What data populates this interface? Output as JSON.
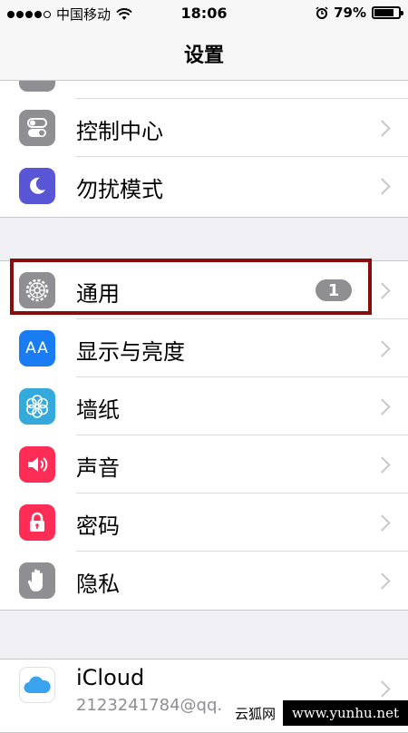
{
  "status_bar": {
    "carrier": "中国移动",
    "time": "18:06",
    "battery_percent": "79%",
    "battery_level": 0.79,
    "signal_dots": 4
  },
  "nav": {
    "title": "设置"
  },
  "groups": [
    {
      "items": [
        {
          "label": "控制中心",
          "icon": "control-center-icon",
          "color": "#8e8e93"
        },
        {
          "label": "勿扰模式",
          "icon": "moon-icon",
          "color": "#5856d6"
        }
      ]
    },
    {
      "items": [
        {
          "label": "通用",
          "icon": "gear-icon",
          "color": "#8e8e93",
          "badge": "1"
        },
        {
          "label": "显示与亮度",
          "icon": "text-size-icon",
          "color": "#1a7cf2"
        },
        {
          "label": "墙纸",
          "icon": "flower-icon",
          "color": "#34aadc"
        },
        {
          "label": "声音",
          "icon": "speaker-icon",
          "color": "#ff2d55"
        },
        {
          "label": "密码",
          "icon": "lock-icon",
          "color": "#ff2d55"
        },
        {
          "label": "隐私",
          "icon": "hand-icon",
          "color": "#8e8e93"
        }
      ]
    },
    {
      "items": [
        {
          "label": "iCloud",
          "sublabel": "2123241784@qq.",
          "icon": "cloud-icon",
          "color": "#ffffff"
        }
      ]
    }
  ],
  "icons": {
    "text_size_glyph": "AA"
  },
  "watermark": {
    "left": "云狐网",
    "right": "www.yunhu.net"
  }
}
